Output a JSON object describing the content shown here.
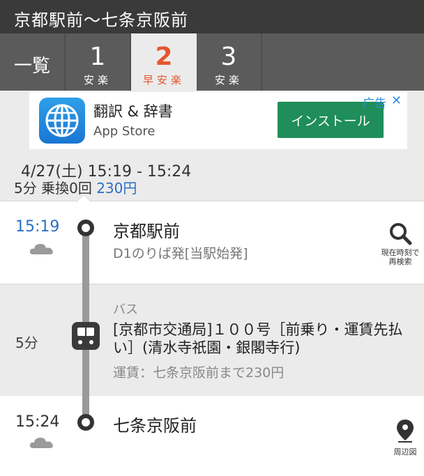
{
  "header": {
    "title": "京都駅前〜七条京阪前"
  },
  "tabs": [
    {
      "label": "一覧"
    },
    {
      "num": "1",
      "sub": "安楽"
    },
    {
      "num": "2",
      "sub": "早安楽"
    },
    {
      "num": "3",
      "sub": "安楽"
    }
  ],
  "ad": {
    "title": "翻訳 & 辞書",
    "subtitle": "App Store",
    "install": "インストール",
    "badge": "广告",
    "close": "✕"
  },
  "summary": {
    "time_range": "4/27(土) 15:19 - 15:24",
    "duration": "5分",
    "transfers": "乗換0回",
    "fare": "230円"
  },
  "departure": {
    "time": "15:19",
    "station": "京都駅前",
    "platform": "D1のりば発[当駅始発]",
    "search_caption_1": "現在時刻で",
    "search_caption_2": "再検索"
  },
  "segment": {
    "mode": "バス",
    "duration": "5分",
    "line": "[京都市交通局]１００号［前乗り・運賃先払い］(清水寺祇園・銀閣寺行)",
    "fare": "運賃：七条京阪前まで230円"
  },
  "arrival": {
    "time": "15:24",
    "station": "七条京阪前",
    "map_caption": "周辺図"
  },
  "colors": {
    "accent_orange": "#e4572e",
    "link_blue": "#2a6fc4",
    "install_green": "#1f8e5a",
    "header_bg": "#3a3a3a",
    "tabs_bg": "#5b5b5b"
  }
}
